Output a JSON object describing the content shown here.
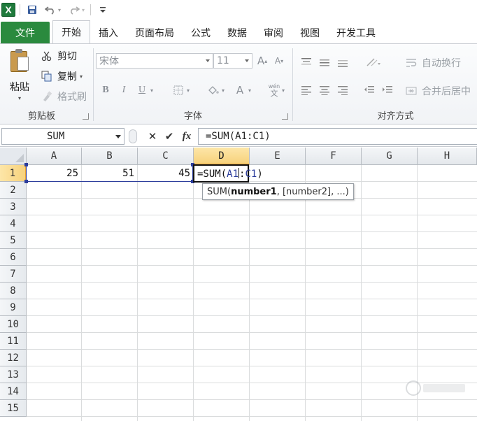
{
  "quick_access": {
    "logo_letter": "X",
    "buttons": [
      "save-icon",
      "undo-icon",
      "redo-icon",
      "customize-icon"
    ]
  },
  "tabs": [
    {
      "label": "文件"
    },
    {
      "label": "开始"
    },
    {
      "label": "插入"
    },
    {
      "label": "页面布局"
    },
    {
      "label": "公式"
    },
    {
      "label": "数据"
    },
    {
      "label": "审阅"
    },
    {
      "label": "视图"
    },
    {
      "label": "开发工具"
    }
  ],
  "ribbon": {
    "clipboard": {
      "paste_label": "粘贴",
      "cut_label": "剪切",
      "copy_label": "复制",
      "format_painter_label": "格式刷",
      "group_label": "剪贴板"
    },
    "font": {
      "font_name": "宋体",
      "font_size": "11",
      "grow_label": "A",
      "shrink_label": "A",
      "bold_label": "B",
      "italic_label": "I",
      "underline_label": "U",
      "font_color_label": "A",
      "phonetic_label": "wén",
      "group_label": "字体"
    },
    "alignment": {
      "wrap_label": "自动换行",
      "merge_label": "合并后居中",
      "group_label": "对齐方式"
    }
  },
  "formula_bar": {
    "name_box": "SUM",
    "cancel_label": "✕",
    "enter_label": "✔",
    "fx_label": "fx",
    "formula": "=SUM(A1:C1)"
  },
  "grid": {
    "columns": [
      "A",
      "B",
      "C",
      "D",
      "E",
      "F",
      "G",
      "H"
    ],
    "active_column": "D",
    "rows": [
      "1",
      "2",
      "3",
      "4",
      "5",
      "6",
      "7",
      "8",
      "9",
      "10",
      "11",
      "12",
      "13",
      "14",
      "15"
    ],
    "active_row": "1",
    "cells": {
      "A1": "25",
      "B1": "51",
      "C1": "45"
    },
    "editing_cell": {
      "prefix": "=SUM(",
      "ref1": "A1",
      "colon": ":",
      "ref2": "C1",
      "suffix": ")"
    },
    "tooltip": {
      "func": "SUM(",
      "arg1": "number1",
      "rest": ", [number2], ...)"
    }
  },
  "colors": {
    "file_tab": "#2a8a3e",
    "active_header": "#f7d27c",
    "reference_blue": "#2c3d9c"
  }
}
